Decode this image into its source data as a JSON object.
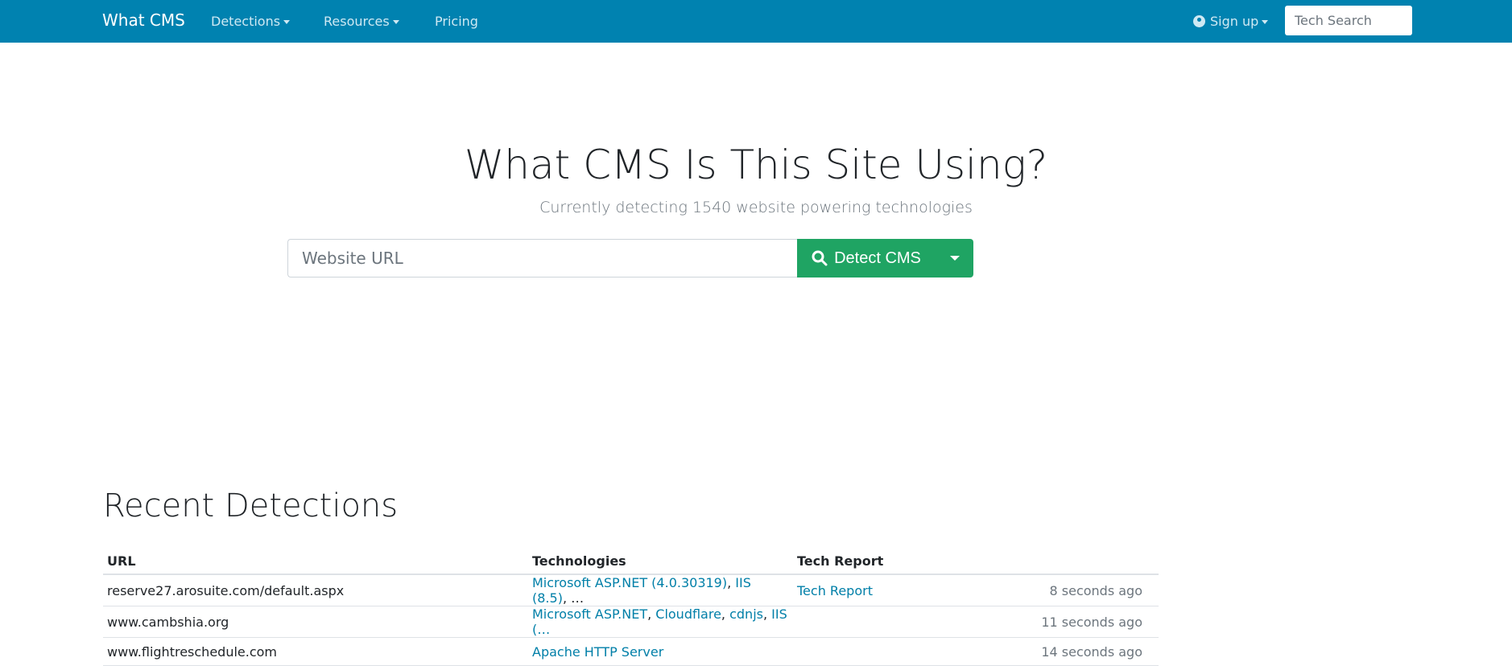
{
  "nav": {
    "brand": "What CMS",
    "items": [
      "Detections",
      "Resources",
      "Pricing"
    ],
    "signup": "Sign up",
    "search_placeholder": "Tech Search"
  },
  "hero": {
    "title": "What CMS Is This Site Using?",
    "subtitle": "Currently detecting 1540 website powering technologies",
    "url_placeholder": "Website URL",
    "detect_label": "Detect CMS"
  },
  "recent": {
    "title": "Recent Detections",
    "headers": [
      "URL",
      "Technologies",
      "Tech Report",
      ""
    ],
    "rows": [
      {
        "url": "reserve27.arosuite.com/default.aspx",
        "tech": [
          {
            "t": "Microsoft ASP.NET (4.0.30319)",
            "s": ", "
          },
          {
            "t": "IIS (8.5)",
            "s": ", …"
          }
        ],
        "report": "Tech Report",
        "time": "8 seconds ago"
      },
      {
        "url": "www.cambshia.org",
        "tech": [
          {
            "t": "Microsoft ASP.NET",
            "s": ", "
          },
          {
            "t": "Cloudflare",
            "s": ", "
          },
          {
            "t": "cdnjs",
            "s": ", "
          },
          {
            "t": "IIS (…",
            "s": ""
          }
        ],
        "report": "",
        "time": "11 seconds ago"
      },
      {
        "url": "www.flightreschedule.com",
        "tech": [
          {
            "t": "Apache HTTP Server",
            "s": ""
          }
        ],
        "report": "",
        "time": "14 seconds ago"
      }
    ]
  },
  "colors": {
    "navbar": "#0082b0",
    "button": "#1fa463",
    "link": "#007fa8"
  }
}
